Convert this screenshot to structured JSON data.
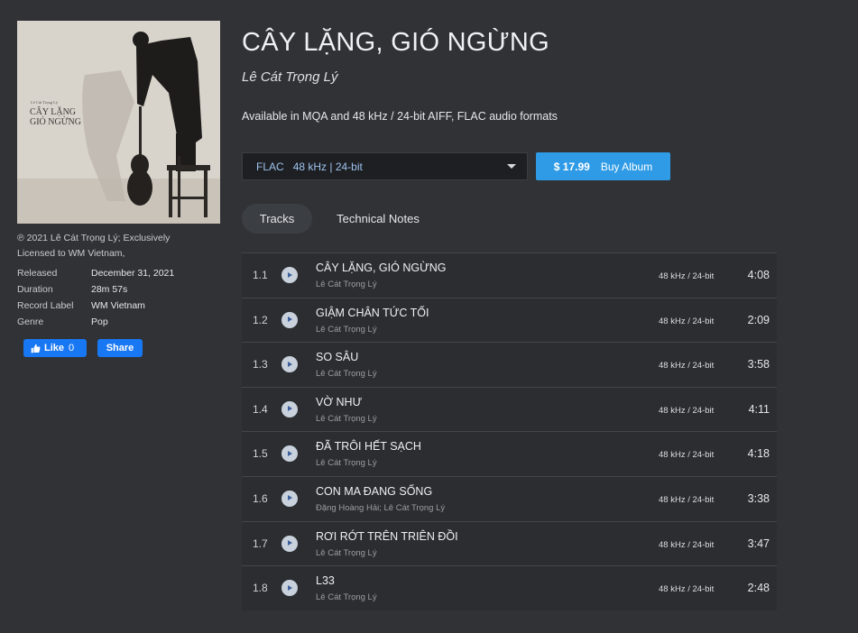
{
  "album": {
    "cover_text": [
      "Lê Cát Trọng Lý",
      "CÂY LẶNG",
      "GIÓ NGỪNG"
    ],
    "title": "CÂY LẶNG, GIÓ NGỪNG",
    "artist": "Lê Cát Trọng Lý",
    "formats_text": "Available in MQA and 48 kHz / 24-bit AIFF, FLAC audio formats",
    "copyright": "℗ 2021 Lê Cát Trọng Lý; Exclusively Licensed to WM Vietnam,"
  },
  "meta": [
    {
      "key": "Released",
      "value": "December 31, 2021"
    },
    {
      "key": "Duration",
      "value": "28m 57s"
    },
    {
      "key": "Record Label",
      "value": "WM Vietnam"
    },
    {
      "key": "Genre",
      "value": "Pop"
    }
  ],
  "social": {
    "like_label": "Like",
    "like_count": "0",
    "share_label": "Share"
  },
  "purchase": {
    "format": "FLAC",
    "quality": "48 kHz | 24-bit",
    "price": "$ 17.99",
    "buy_label": "Buy Album"
  },
  "tabs": [
    {
      "label": "Tracks",
      "active": true
    },
    {
      "label": "Technical Notes",
      "active": false
    }
  ],
  "tracks": [
    {
      "num": "1.1",
      "name": "CÂY LẶNG, GIÓ NGỪNG",
      "artist": "Lê Cát Trọng Lý",
      "quality": "48 kHz / 24-bit",
      "duration": "4:08"
    },
    {
      "num": "1.2",
      "name": "GIẬM CHÂN TỨC TỐI",
      "artist": "Lê Cát Trọng Lý",
      "quality": "48 kHz / 24-bit",
      "duration": "2:09"
    },
    {
      "num": "1.3",
      "name": "SO SÂU",
      "artist": "Lê Cát Trọng Lý",
      "quality": "48 kHz / 24-bit",
      "duration": "3:58"
    },
    {
      "num": "1.4",
      "name": "VỜ NHƯ",
      "artist": "Lê Cát Trọng Lý",
      "quality": "48 kHz / 24-bit",
      "duration": "4:11"
    },
    {
      "num": "1.5",
      "name": "ĐÃ TRÔI HẾT SẠCH",
      "artist": "Lê Cát Trọng Lý",
      "quality": "48 kHz / 24-bit",
      "duration": "4:18"
    },
    {
      "num": "1.6",
      "name": "CON MA ĐANG SỐNG",
      "artist": "Đặng Hoàng Hải; Lê Cát Trọng Lý",
      "quality": "48 kHz / 24-bit",
      "duration": "3:38"
    },
    {
      "num": "1.7",
      "name": "RƠI RỚT TRÊN TRIÊN ĐỒI",
      "artist": "Lê Cát Trọng Lý",
      "quality": "48 kHz / 24-bit",
      "duration": "3:47"
    },
    {
      "num": "1.8",
      "name": "L33",
      "artist": "Lê Cát Trọng Lý",
      "quality": "48 kHz / 24-bit",
      "duration": "2:48"
    }
  ],
  "colors": {
    "background": "#303236",
    "accent": "#2f9be6",
    "facebook": "#1877f2",
    "quality_text": "#9ec2ee"
  }
}
